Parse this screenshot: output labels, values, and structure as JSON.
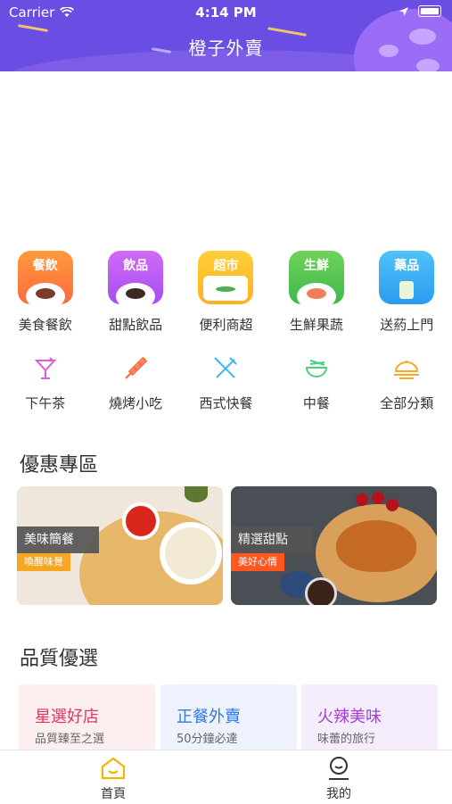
{
  "status_bar": {
    "carrier": "Carrier",
    "time": "4:14 PM"
  },
  "header": {
    "title": "橙子外賣"
  },
  "categories_top": [
    {
      "tile_label": "餐飲",
      "name": "美食餐飲",
      "color_top": "#ff9a3c",
      "color_bottom": "#ff6a3d"
    },
    {
      "tile_label": "飲品",
      "name": "甜點飲品",
      "color_top": "#d06af7",
      "color_bottom": "#a54ef0"
    },
    {
      "tile_label": "超市",
      "name": "便利商超",
      "color_top": "#ffcf3a",
      "color_bottom": "#ffb020"
    },
    {
      "tile_label": "生鮮",
      "name": "生鮮果蔬",
      "color_top": "#6fd25a",
      "color_bottom": "#3fb94a"
    },
    {
      "tile_label": "藥品",
      "name": "送葯上門",
      "color_top": "#4fc2f7",
      "color_bottom": "#2b9bf0"
    }
  ],
  "categories_bottom": [
    {
      "name": "下午茶",
      "icon": "cocktail-icon",
      "color": "#e35bd8"
    },
    {
      "name": "燒烤小吃",
      "icon": "skewer-icon",
      "color": "#ff6a3d"
    },
    {
      "name": "西式快餐",
      "icon": "fork-knife-icon",
      "color": "#3fb7f0"
    },
    {
      "name": "中餐",
      "icon": "noodle-bowl-icon",
      "color": "#4cd07d"
    },
    {
      "name": "全部分類",
      "icon": "dish-icon",
      "color": "#ffa726"
    }
  ],
  "promo": {
    "title": "優惠專區",
    "banners": [
      {
        "label": "美味簡餐",
        "sub": "喚醒味覺",
        "sub_color": "#f5a623"
      },
      {
        "label": "精選甜點",
        "sub": "美好心情",
        "sub_color": "#ff5722"
      }
    ]
  },
  "quality": {
    "title": "品質優選",
    "cards": [
      {
        "title": "星選好店",
        "subtitle": "品質臻至之選",
        "bg": "#fdeef0",
        "color": "#e8335a"
      },
      {
        "title": "正餐外賣",
        "subtitle": "50分鐘必達",
        "bg": "#eef2fd",
        "color": "#2f78e8"
      },
      {
        "title": "火辣美味",
        "subtitle": "味蕾的旅行",
        "bg": "#f5edfb",
        "color": "#a23fd6"
      }
    ]
  },
  "tabs": [
    {
      "label": "首頁",
      "icon": "home-icon"
    },
    {
      "label": "我的",
      "icon": "profile-icon"
    }
  ]
}
